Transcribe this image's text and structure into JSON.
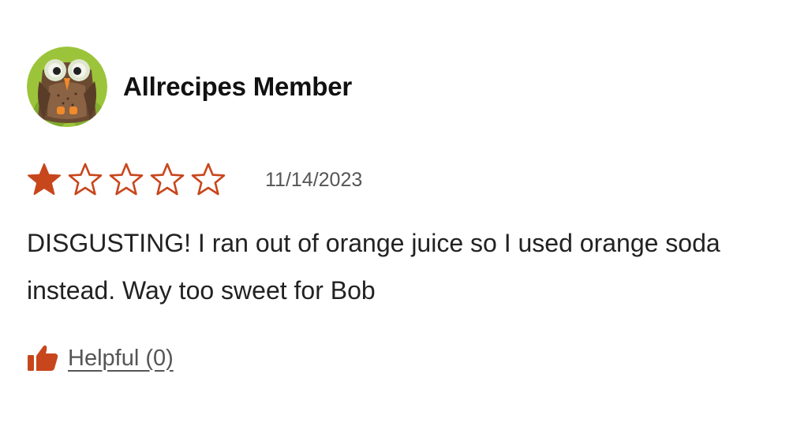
{
  "review": {
    "author": {
      "name": "Allrecipes Member",
      "avatar_icon": "owl-avatar-icon"
    },
    "rating": {
      "value": 1,
      "max": 5,
      "filled_color": "#c8461c",
      "outline_color": "#c8461c"
    },
    "date": "11/14/2023",
    "text": "DISGUSTING! I ran out of orange juice so I used orange soda instead. Way too sweet for Bob",
    "helpful": {
      "label": "Helpful (0)",
      "icon": "thumbs-up-icon",
      "icon_color": "#c8461c"
    }
  }
}
